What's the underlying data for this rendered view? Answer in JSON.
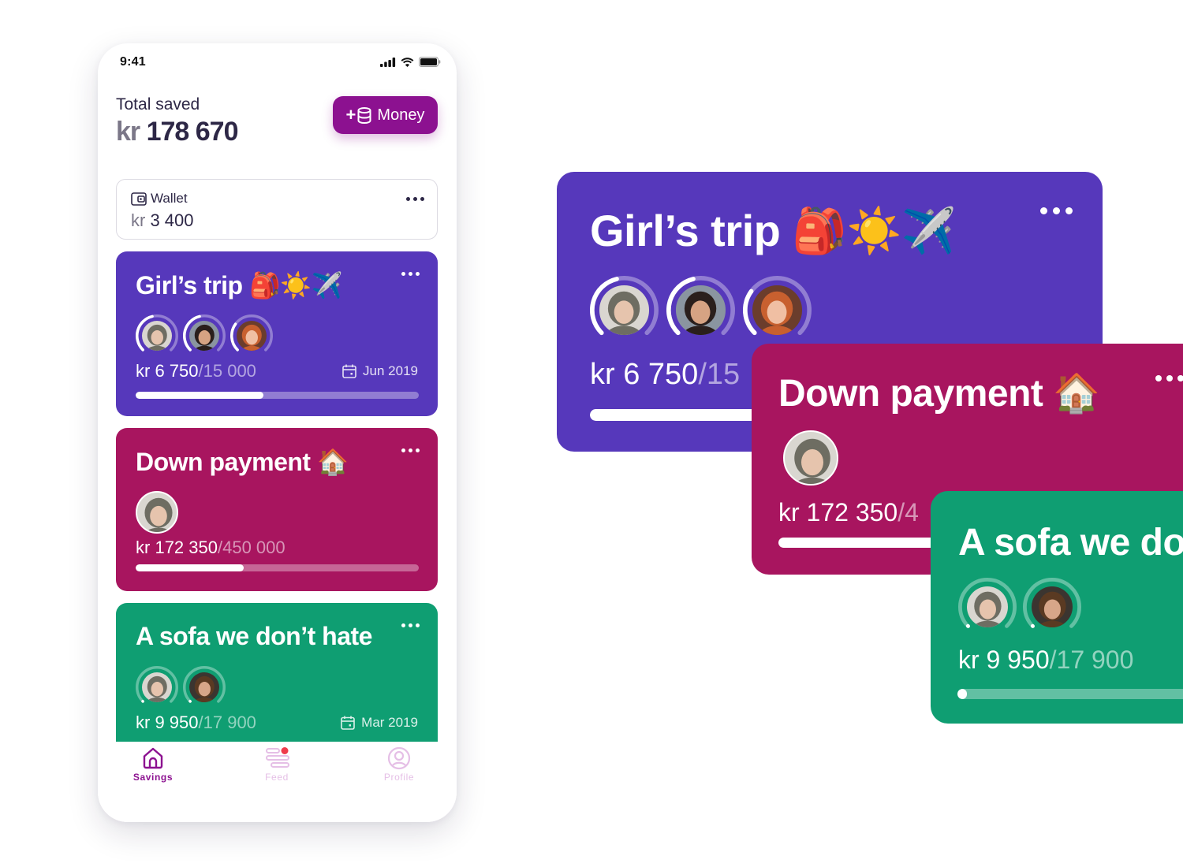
{
  "status_bar": {
    "time": "9:41",
    "icons": [
      "signal-icon",
      "wifi-icon",
      "battery-icon"
    ]
  },
  "header": {
    "total_label": "Total saved",
    "currency": "kr",
    "total_value": "178 670",
    "add_money_button": {
      "icon": "plus-coins-icon",
      "plus": "+",
      "label": "Money"
    }
  },
  "wallet": {
    "icon": "wallet-icon",
    "label": "Wallet",
    "currency": "kr",
    "value": "3 400",
    "menu_icon": "more-dots-icon"
  },
  "colors": {
    "brand": "#8c1190",
    "purple_card": "#5638bb",
    "magenta_card": "#a8155f",
    "green_card": "#0f9e72",
    "notification_dot": "#ef3b4b"
  },
  "goals": [
    {
      "id": "girls-trip",
      "title": "Girl’s trip",
      "emoji": "🎒☀️✈️",
      "currency": "kr",
      "saved": "6 750",
      "target": "/15 000",
      "progress": 0.45,
      "date": "Jun 2019",
      "members": [
        {
          "name": "member-1",
          "share": 0.45
        },
        {
          "name": "member-2",
          "share": 0.45
        },
        {
          "name": "member-3",
          "share": 0.3
        }
      ]
    },
    {
      "id": "down-payment",
      "title": "Down payment",
      "emoji": "🏠",
      "currency": "kr",
      "saved": "172 350",
      "target": "/450 000",
      "progress": 0.383,
      "date": null,
      "members": [
        {
          "name": "member-1",
          "share": null
        }
      ]
    },
    {
      "id": "sofa",
      "title": "A sofa we don’t hate",
      "emoji": "",
      "currency": "kr",
      "saved": "9 950",
      "target": "/17 900",
      "progress": 0.01,
      "date": "Mar 2019",
      "members": [
        {
          "name": "member-1",
          "share": 0.0
        },
        {
          "name": "member-4",
          "share": 0.0
        }
      ]
    }
  ],
  "zoomed_cards": {
    "girls_trip_target_visible": "/15",
    "down_payment_target_visible": "/4",
    "sofa_title_visible": "A sofa we do"
  },
  "tabbar": {
    "tabs": [
      {
        "label": "Savings",
        "icon": "home-icon",
        "active": true
      },
      {
        "label": "Feed",
        "icon": "feed-icon",
        "active": false,
        "badge": true
      },
      {
        "label": "Profile",
        "icon": "profile-icon",
        "active": false
      }
    ]
  }
}
